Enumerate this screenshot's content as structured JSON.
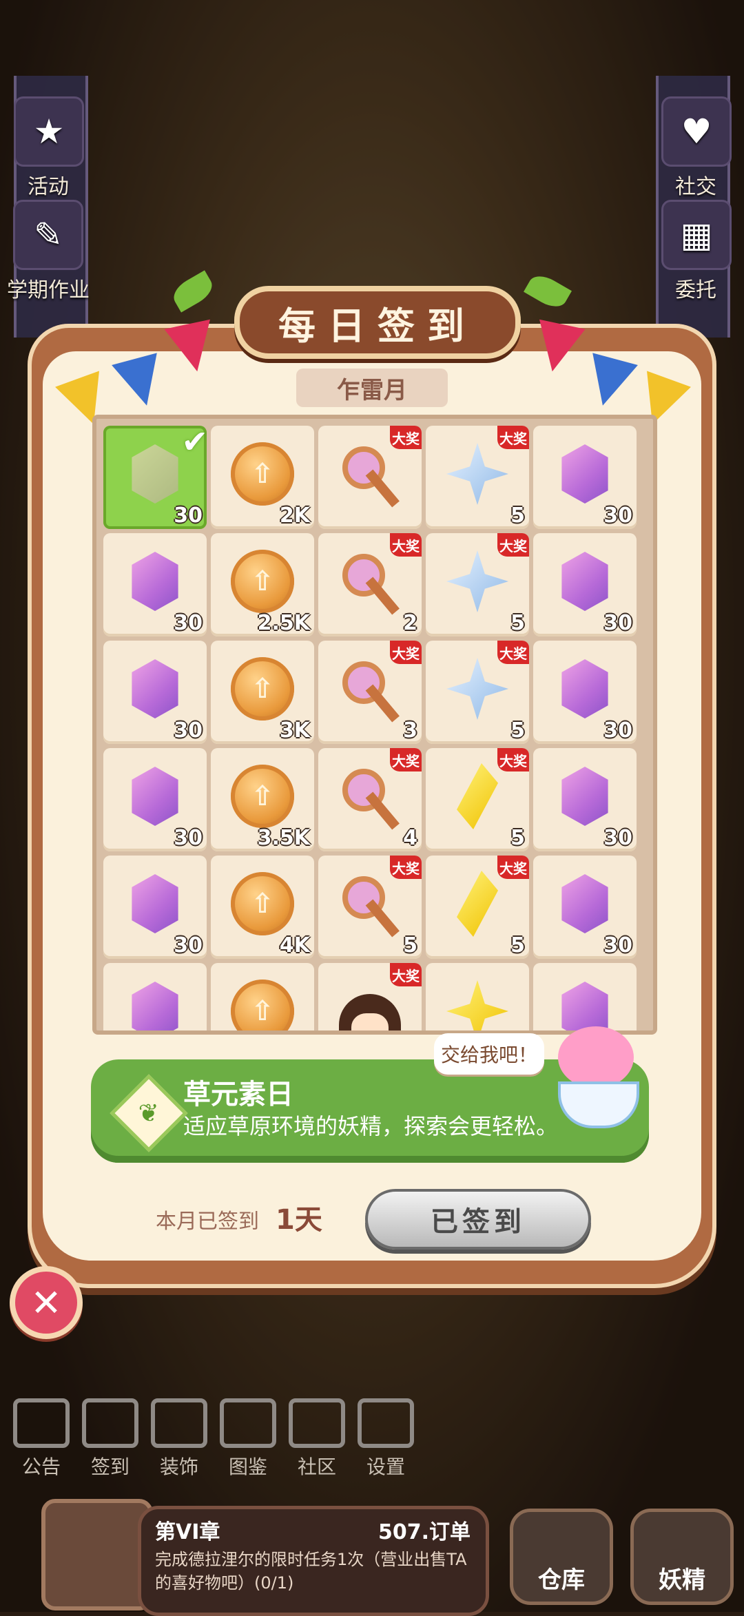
{
  "side_menu_left": [
    {
      "label": "活动",
      "icon": "event-icon"
    },
    {
      "label": "学期作业",
      "icon": "homework-icon"
    }
  ],
  "side_menu_right": [
    {
      "label": "社交",
      "icon": "social-icon"
    },
    {
      "label": "委托",
      "icon": "commission-icon"
    }
  ],
  "modal": {
    "title": "每日签到",
    "month": "乍雷月",
    "big_prize_badge": "大奖",
    "element_day": {
      "title": "草元素日",
      "description": "适应草原环境的妖精，探索会更轻松。",
      "speech": "交给我吧！"
    },
    "signed_label": "本月已签到",
    "signed_count": "1天",
    "signed_button": "已签到"
  },
  "calendar": [
    {
      "item": "gem-gray",
      "qty": "30",
      "claimed": true,
      "big": false
    },
    {
      "item": "coin",
      "qty": "2K",
      "big": false
    },
    {
      "item": "key",
      "qty": "",
      "big": true
    },
    {
      "item": "star",
      "qty": "5",
      "big": true
    },
    {
      "item": "gem",
      "qty": "30",
      "big": false
    },
    {
      "item": "gem",
      "qty": "30",
      "big": false
    },
    {
      "item": "coin",
      "qty": "2.5K",
      "big": false
    },
    {
      "item": "key",
      "qty": "2",
      "big": true
    },
    {
      "item": "star",
      "qty": "5",
      "big": true
    },
    {
      "item": "gem",
      "qty": "30",
      "big": false
    },
    {
      "item": "gem",
      "qty": "30",
      "big": false
    },
    {
      "item": "coin",
      "qty": "3K",
      "big": false
    },
    {
      "item": "key",
      "qty": "3",
      "big": true
    },
    {
      "item": "star",
      "qty": "5",
      "big": true
    },
    {
      "item": "gem",
      "qty": "30",
      "big": false
    },
    {
      "item": "gem",
      "qty": "30",
      "big": false
    },
    {
      "item": "coin",
      "qty": "3.5K",
      "big": false
    },
    {
      "item": "key",
      "qty": "4",
      "big": true
    },
    {
      "item": "diamond",
      "qty": "5",
      "big": true
    },
    {
      "item": "gem",
      "qty": "30",
      "big": false
    },
    {
      "item": "gem",
      "qty": "30",
      "big": false
    },
    {
      "item": "coin",
      "qty": "4K",
      "big": false
    },
    {
      "item": "key",
      "qty": "5",
      "big": true
    },
    {
      "item": "diamond",
      "qty": "5",
      "big": true
    },
    {
      "item": "gem",
      "qty": "30",
      "big": false
    },
    {
      "item": "gem",
      "qty": "",
      "big": false
    },
    {
      "item": "coin",
      "qty": "",
      "big": false
    },
    {
      "item": "girl",
      "qty": "",
      "big": true
    },
    {
      "item": "star-gold",
      "qty": "",
      "big": false
    },
    {
      "item": "gem",
      "qty": "",
      "big": false
    }
  ],
  "bottom_menu": [
    {
      "label": "公告",
      "icon": "notice-icon"
    },
    {
      "label": "签到",
      "icon": "checkin-icon"
    },
    {
      "label": "装饰",
      "icon": "decor-icon"
    },
    {
      "label": "图鉴",
      "icon": "codex-icon"
    },
    {
      "label": "社区",
      "icon": "community-icon"
    },
    {
      "label": "设置",
      "icon": "settings-icon"
    }
  ],
  "chapter": {
    "title": "第VI章",
    "gold": "507.订单",
    "task": "完成德拉浬尔的限时任务1次（营业出售TA的喜好物吧）(0/1)"
  },
  "bottom_right": {
    "warehouse": "仓库",
    "fairy": "妖精"
  }
}
